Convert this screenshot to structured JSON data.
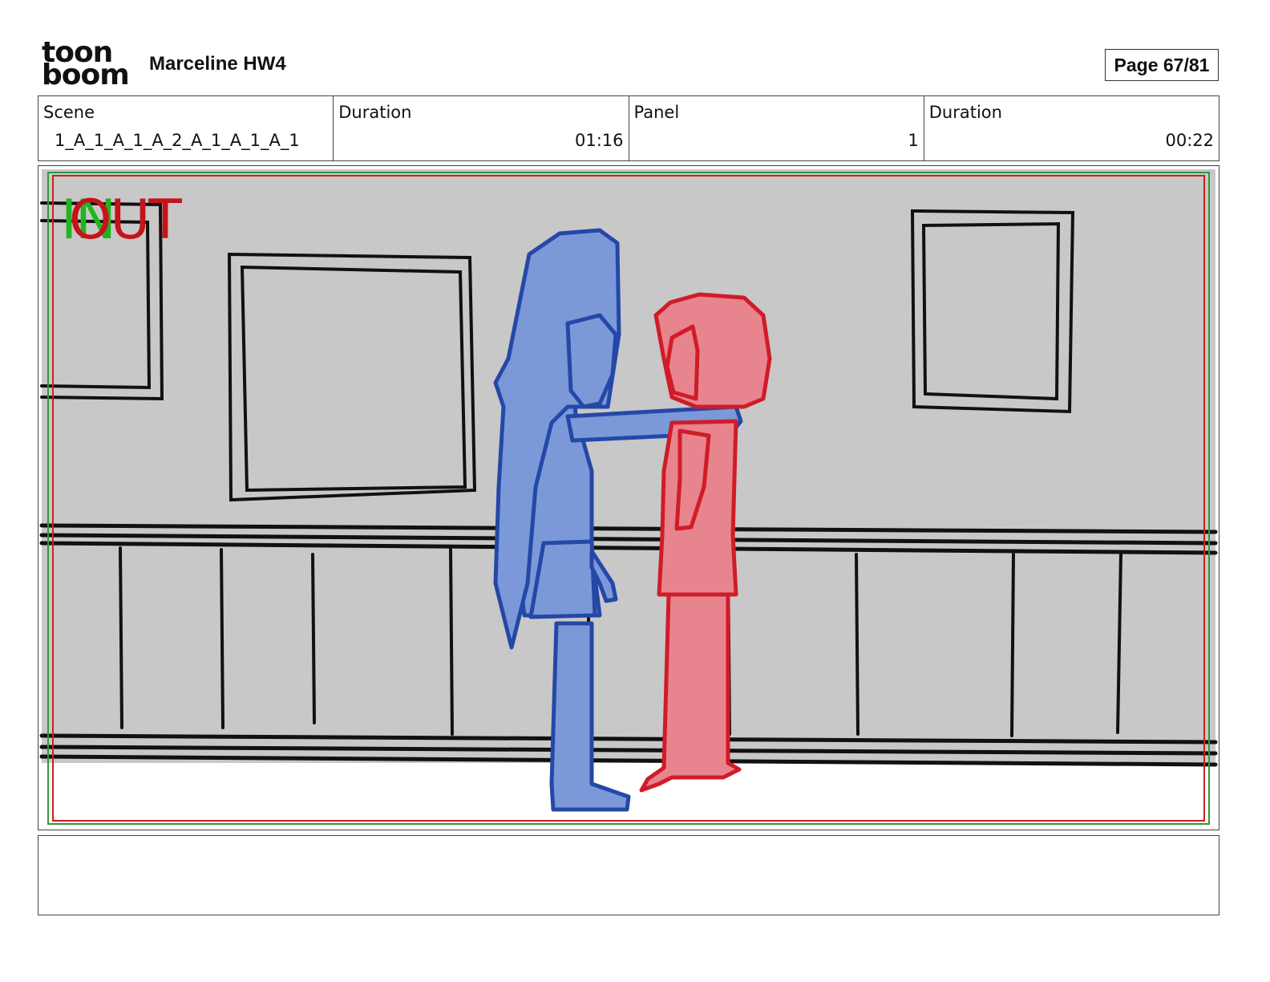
{
  "header": {
    "logo_line1": "toon",
    "logo_line2": "boom",
    "title": "Marceline HW4",
    "page_indicator": "Page 67/81"
  },
  "info": {
    "scene_label": "Scene",
    "scene_value": "1_A_1_A_1_A_2_A_1_A_1_A_1",
    "scene_duration_label": "Duration",
    "scene_duration_value": "01:16",
    "panel_label": "Panel",
    "panel_value": "1",
    "panel_duration_label": "Duration",
    "panel_duration_value": "00:22"
  },
  "panel": {
    "in_marker": "IN",
    "out_marker": "OUT",
    "colors": {
      "wall": "#c8c8c8",
      "floor": "#ffffff",
      "blue_character": "#7b98d8",
      "blue_outline": "#2448a8",
      "red_character": "#e8848e",
      "red_outline": "#d01c28",
      "safe_frame_green": "#2c9a3a",
      "safe_frame_red": "#cc1f1f"
    }
  },
  "notes": {
    "text": ""
  }
}
